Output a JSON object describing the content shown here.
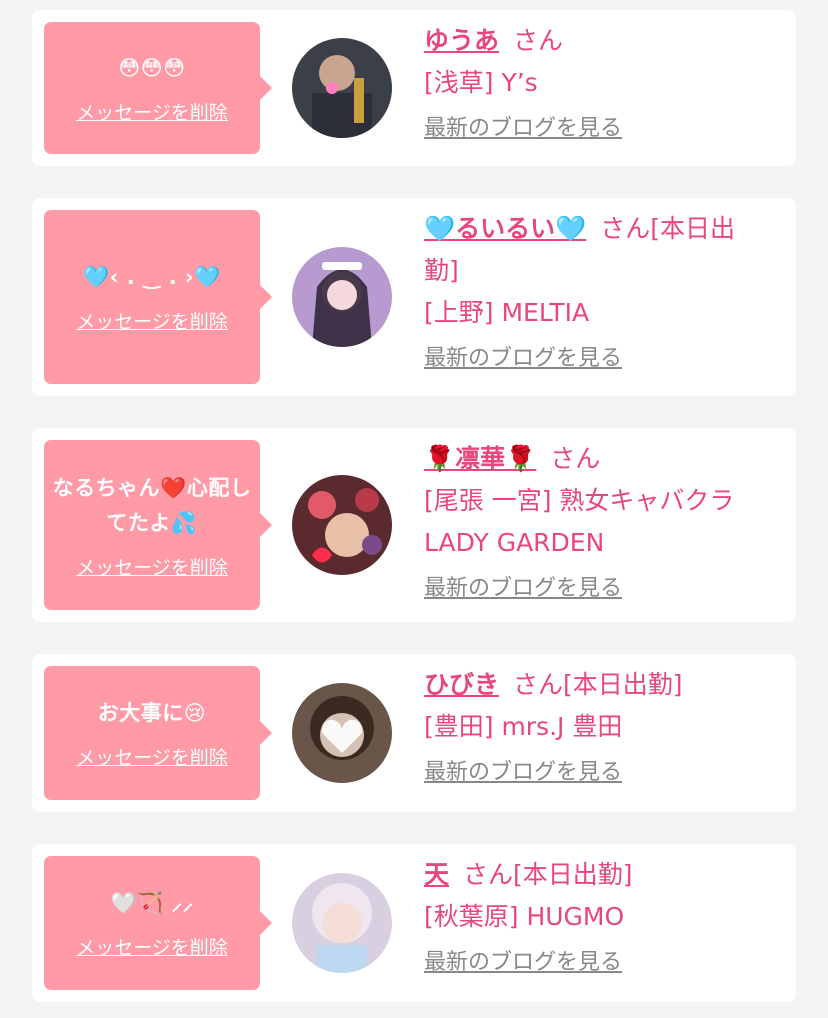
{
  "colors": {
    "accent": "#e8477e",
    "bubble": "#ff9aa6",
    "link_gray": "#888888"
  },
  "delete_label": "メッセージを削除",
  "blog_label": "最新のブログを見る",
  "items": [
    {
      "message": "😳😳😳",
      "name": "ゆうあ",
      "honorific": "さん",
      "status": "",
      "shop": "[浅草] Y’s"
    },
    {
      "message": "🩵‹ . ‿ . ›🩵",
      "name": "🩵るいるい🩵",
      "honorific": "さん",
      "status": "[本日出勤]",
      "shop": "[上野] MELTIA"
    },
    {
      "message": "なるちゃん❤️心配してたよ💦",
      "name": "🌹凛華🌹",
      "honorific": "さん",
      "status": "",
      "shop": "[尾張 一宮] 熟女キャバクラ LADY GARDEN"
    },
    {
      "message": "お大事に😢",
      "name": "ひびき",
      "honorific": "さん",
      "status": "[本日出勤]",
      "shop": "[豊田] mrs.J 豊田"
    },
    {
      "message": "🤍🏹 ⸝⸝",
      "name": "天",
      "honorific": "さん",
      "status": "[本日出勤]",
      "shop": "[秋葉原] HUGMO"
    }
  ]
}
